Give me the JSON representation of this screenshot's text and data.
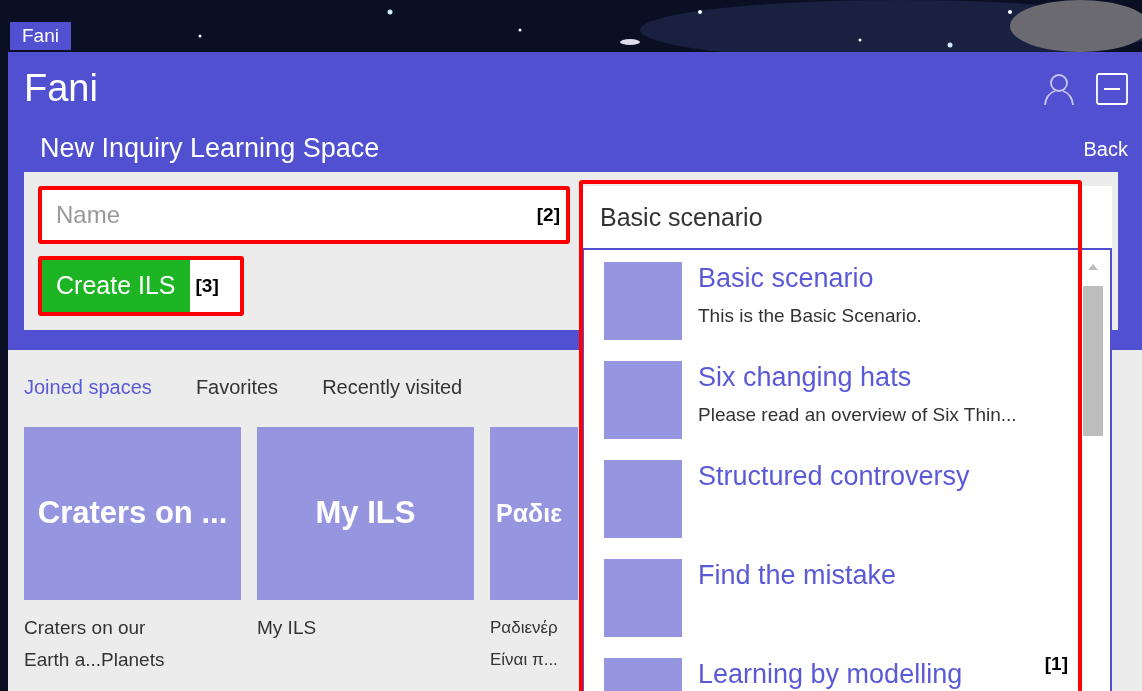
{
  "tag": "Fani",
  "header": {
    "title": "Fani"
  },
  "subheader": {
    "title": "New Inquiry Learning Space",
    "back": "Back"
  },
  "form": {
    "name_field": {
      "placeholder": "Name",
      "annotation": "[2]"
    },
    "create_button": {
      "label": "Create ILS",
      "annotation": "[3]"
    }
  },
  "scenario_search": {
    "value": "Basic scenario",
    "annotation": "[1]",
    "results": [
      {
        "title": "Basic scenario",
        "description": "This is the Basic Scenario."
      },
      {
        "title": "Six changing hats",
        "description": "Please read an overview of Six Thin..."
      },
      {
        "title": "Structured controversy"
      },
      {
        "title": "Find the mistake"
      },
      {
        "title": "Learning by modelling"
      }
    ]
  },
  "tabs": [
    {
      "label": "Joined spaces",
      "selected": true
    },
    {
      "label": "Favorites",
      "selected": false
    },
    {
      "label": "Recently visited",
      "selected": false
    }
  ],
  "spaces": [
    {
      "tile": "Craters on ...",
      "caption_lines": [
        "Craters on our",
        "Earth a...Planets"
      ]
    },
    {
      "tile": "My ILS",
      "caption_lines": [
        "My ILS"
      ]
    },
    {
      "tile": "Ραδιε",
      "caption_lines": [
        "Ραδιενέρ",
        "Είναι π..."
      ]
    }
  ]
}
